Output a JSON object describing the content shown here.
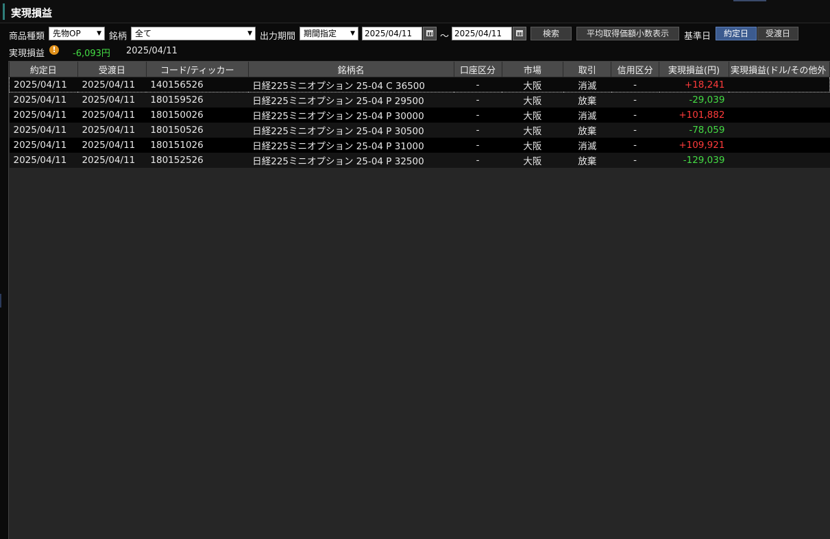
{
  "window": {
    "title": "実現損益"
  },
  "filters": {
    "product_type_label": "商品種類",
    "product_type_value": "先物OP",
    "issue_label": "銘柄",
    "issue_value": "全て",
    "period_label": "出力期間",
    "period_value": "期間指定",
    "date_from": "2025/04/11",
    "range_sep": "～",
    "date_to": "2025/04/11",
    "search_label": "検索",
    "avg_price_label": "平均取得価額小数表示",
    "base_date_label": "基準日",
    "base_date_options": [
      "約定日",
      "受渡日"
    ],
    "base_date_selected": "約定日"
  },
  "summary": {
    "label": "実現損益",
    "warn_symbol": "!",
    "value": "-6,093円",
    "date": "2025/04/11"
  },
  "colors": {
    "profit": "#ff3b3b",
    "loss": "#44dd44",
    "active_tab": "#3c5b8f"
  },
  "table": {
    "headers": [
      "約定日",
      "受渡日",
      "コード/ティッカー",
      "銘柄名",
      "口座区分",
      "市場",
      "取引",
      "信用区分",
      "実現損益(円)",
      "実現損益(ドル/その他外"
    ],
    "rows": [
      [
        "2025/04/11",
        "2025/04/11",
        "140156526",
        "日経225ミニオプション 25-04 C 36500",
        "-",
        "大阪",
        "消滅",
        "-",
        "+18,241",
        ""
      ],
      [
        "2025/04/11",
        "2025/04/11",
        "180159526",
        "日経225ミニオプション 25-04 P 29500",
        "-",
        "大阪",
        "放棄",
        "-",
        "-29,039",
        ""
      ],
      [
        "2025/04/11",
        "2025/04/11",
        "180150026",
        "日経225ミニオプション 25-04 P 30000",
        "-",
        "大阪",
        "消滅",
        "-",
        "+101,882",
        ""
      ],
      [
        "2025/04/11",
        "2025/04/11",
        "180150526",
        "日経225ミニオプション 25-04 P 30500",
        "-",
        "大阪",
        "放棄",
        "-",
        "-78,059",
        ""
      ],
      [
        "2025/04/11",
        "2025/04/11",
        "180151026",
        "日経225ミニオプション 25-04 P 31000",
        "-",
        "大阪",
        "消滅",
        "-",
        "+109,921",
        ""
      ],
      [
        "2025/04/11",
        "2025/04/11",
        "180152526",
        "日経225ミニオプション 25-04 P 32500",
        "-",
        "大阪",
        "放棄",
        "-",
        "-129,039",
        ""
      ]
    ]
  }
}
